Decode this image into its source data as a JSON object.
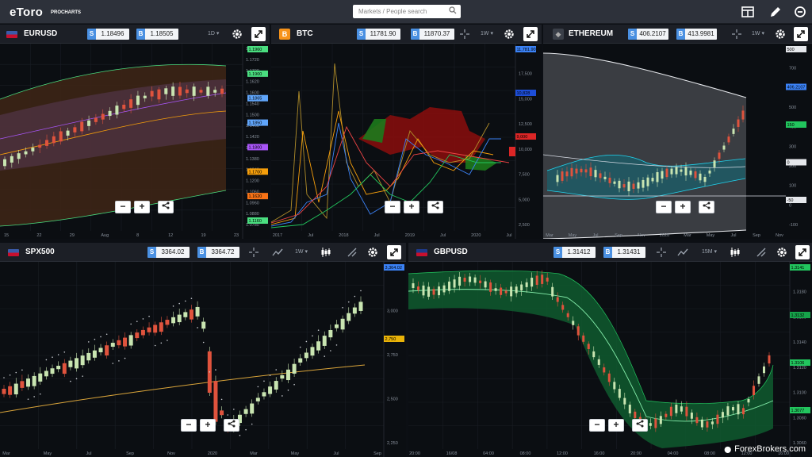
{
  "app": {
    "logo": "eToro",
    "subtitle": "PROCHARTS"
  },
  "search": {
    "placeholder": "Markets / People search"
  },
  "watermark": "ForexBrokers.com",
  "zoom_controls": {
    "minus": "−",
    "plus": "+"
  },
  "panels": {
    "eurusd": {
      "symbol": "EURUSD",
      "sell_label": "S",
      "sell": "1.18496",
      "buy_label": "B",
      "buy": "1.18505",
      "timeframe": "1D ▾",
      "x_ticks": [
        "15",
        "22",
        "29",
        "Aug",
        "8",
        "12",
        "19",
        "23"
      ],
      "y_ticks": [
        "1.1960",
        "1.1720",
        "1.1700",
        "1.1620",
        "1.1600",
        "1.1540",
        "1.1500",
        "1.1460",
        "1.1420",
        "1.1400",
        "1.1380",
        "1.1340",
        "1.1200",
        "1.1060",
        "1.0960",
        "1.0880",
        "1.0780"
      ],
      "price_tags": [
        {
          "text": "1.1960",
          "color": "#4ade80"
        },
        {
          "text": "1.1900",
          "color": "#4ade80"
        },
        {
          "text": "1.1865",
          "color": "#60a5fa"
        },
        {
          "text": "1.1850",
          "color": "#60a5fa"
        },
        {
          "text": "1.1800",
          "color": "#a855f7"
        },
        {
          "text": "1.1700",
          "color": "#f59e0b"
        },
        {
          "text": "1.1620",
          "color": "#f97316"
        },
        {
          "text": "1.1160",
          "color": "#4ade80"
        }
      ]
    },
    "btc": {
      "symbol": "BTC",
      "badge": "B",
      "sell_label": "S",
      "sell": "11781.90",
      "buy_label": "B",
      "buy": "11870.37",
      "timeframe": "1W ▾",
      "x_ticks": [
        "2017",
        "Jul",
        "2018",
        "Jul",
        "2019",
        "Jul",
        "2020",
        "Jul"
      ],
      "y_ticks": [
        "20,000",
        "17,500",
        "15,000",
        "12,500",
        "10,000",
        "7,500",
        "5,000",
        "2,500"
      ],
      "price_tags": [
        {
          "text": "11,781.90",
          "color": "#3b82f6"
        },
        {
          "text": "10,828",
          "color": "#1d4ed8"
        },
        {
          "text": "9,000",
          "color": "#dc2626"
        }
      ]
    },
    "eth": {
      "symbol": "ETHEREUM",
      "badge": "◆",
      "sell_label": "S",
      "sell": "406.2107",
      "buy_label": "B",
      "buy": "413.9981",
      "timeframe": "1W ▾",
      "x_ticks": [
        "Mar",
        "May",
        "Jul",
        "Sep",
        "Nov",
        "2020",
        "Mar",
        "May",
        "Jul",
        "Sep",
        "Nov"
      ],
      "y_ticks": [
        "800",
        "700",
        "600",
        "500",
        "400",
        "300",
        "200",
        "100",
        "0",
        "-100"
      ],
      "price_tags": [
        {
          "text": "500",
          "color": "#e5e7eb"
        },
        {
          "text": "406.2107",
          "color": "#3b82f6"
        },
        {
          "text": "150",
          "color": "#22c55e"
        },
        {
          "text": "0",
          "color": "#e5e7eb"
        },
        {
          "text": "-50",
          "color": "#e5e7eb"
        }
      ]
    },
    "spx": {
      "symbol": "SPX500",
      "sell_label": "S",
      "sell": "3364.02",
      "buy_label": "B",
      "buy": "3364.72",
      "timeframe": "1W ▾",
      "x_ticks": [
        "Mar",
        "May",
        "Jul",
        "Sep",
        "Nov",
        "2020",
        "Mar",
        "May",
        "Jul",
        "Sep"
      ],
      "y_ticks": [
        "3,250",
        "3,000",
        "2,750",
        "2,500",
        "2,250"
      ],
      "price_tags": [
        {
          "text": "3,364.02",
          "color": "#3b82f6"
        },
        {
          "text": "2,750",
          "color": "#eab308"
        }
      ]
    },
    "gbp": {
      "symbol": "GBPUSD",
      "sell_label": "S",
      "sell": "1.31412",
      "buy_label": "B",
      "buy": "1.31431",
      "timeframe": "15M ▾",
      "x_ticks": [
        "20:00",
        "16/08",
        "04:00",
        "08:00",
        "12:00",
        "16:00",
        "20:00",
        "04:00",
        "08:00",
        "12:00",
        "16:00"
      ],
      "y_ticks": [
        "1.3200",
        "1.3180",
        "1.3160",
        "1.3140",
        "1.3120",
        "1.3100",
        "1.3080",
        "1.3060"
      ],
      "price_tags": [
        {
          "text": "1.3141",
          "color": "#22c55e"
        },
        {
          "text": "1.3132",
          "color": "#16a34a"
        },
        {
          "text": "1.3106",
          "color": "#22c55e"
        },
        {
          "text": "1.3077",
          "color": "#22c55e"
        }
      ]
    }
  },
  "colors": {
    "up": "#c9e5b1",
    "down": "#e0533d",
    "sell_badge": "#4a90e2",
    "topbar": "#2d313a"
  }
}
